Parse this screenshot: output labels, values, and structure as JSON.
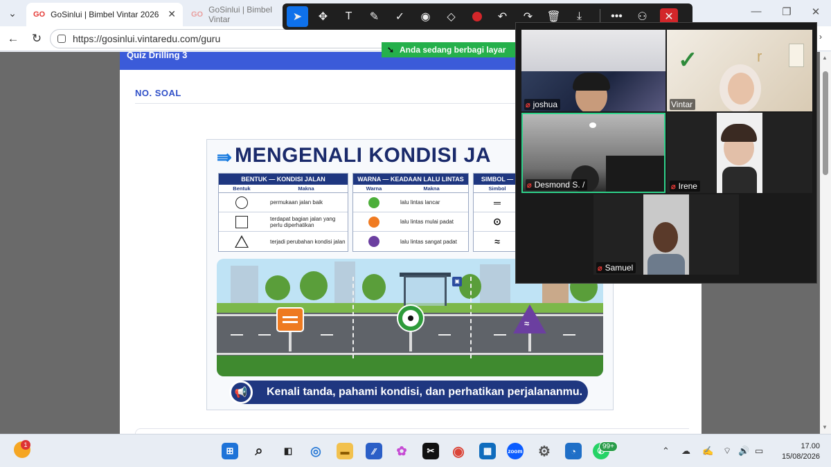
{
  "browser": {
    "tabs": [
      {
        "logo": "GO",
        "title": "GoSinlui | Bimbel Vintar 2026",
        "active": true
      },
      {
        "logo": "GO",
        "title": "GoSinlui | Bimbel Vintar",
        "active": false
      }
    ],
    "url": "https://gosinlui.vintaredu.com/guru"
  },
  "annotation_toolbar": {
    "tools": [
      "select-icon",
      "move-icon",
      "text-icon",
      "pen-icon",
      "check-icon",
      "spotlight-icon",
      "eraser-icon",
      "record-icon",
      "undo-icon",
      "redo-icon",
      "trash-icon",
      "download-icon",
      "more-icon",
      "person-icon",
      "close-icon"
    ],
    "colors": {
      "selected": "#0e71eb",
      "record": "#d3262a"
    }
  },
  "share_banner": {
    "text": "Anda sedang berbagi layar"
  },
  "page": {
    "header": "Quiz Drilling 3",
    "no_soal": "NO. SOAL"
  },
  "infographic": {
    "title": "MENGENALI KONDISI JA",
    "tables": {
      "bentuk": {
        "header": "BENTUK — KONDISI JALAN",
        "col1": "Bentuk",
        "col2": "Makna",
        "rows": [
          {
            "shape": "circle",
            "meaning": "permukaan jalan baik"
          },
          {
            "shape": "square",
            "meaning": "terdapat bagian jalan yang perlu diperhatikan"
          },
          {
            "shape": "triangle",
            "meaning": "terjadi perubahan kondisi jalan"
          }
        ]
      },
      "warna": {
        "header": "WARNA — KEADAAN LALU LINTAS",
        "col1": "Warna",
        "col2": "Makna",
        "rows": [
          {
            "color": "#4caf3a",
            "meaning": "lalu lintas lancar"
          },
          {
            "color": "#f07b22",
            "meaning": "lalu lintas mulai padat"
          },
          {
            "color": "#6b3fa0",
            "meaning": "lalu lintas sangat padat"
          }
        ]
      },
      "simbol": {
        "header": "SIMBOL —",
        "col1": "Simbol",
        "rows": [
          "═",
          "⊙",
          "≈"
        ]
      }
    },
    "slogan": "Kenali tanda, pahami kondisi, dan perhatikan perjalananmu."
  },
  "zoom": {
    "participants": [
      {
        "name": "joshua",
        "muted": true
      },
      {
        "name": "Vintar",
        "muted": false
      },
      {
        "name": "Desmond S. /",
        "muted": true,
        "speaking": true
      },
      {
        "name": "Irene",
        "muted": true
      },
      {
        "name": "Samuel",
        "muted": true
      }
    ],
    "vintar_logo_text": "r"
  },
  "taskbar": {
    "notification_count": "1",
    "whatsapp_badge": "99+",
    "zoom_label": "zoom",
    "time": "17.00",
    "date": "15/08/2026"
  }
}
